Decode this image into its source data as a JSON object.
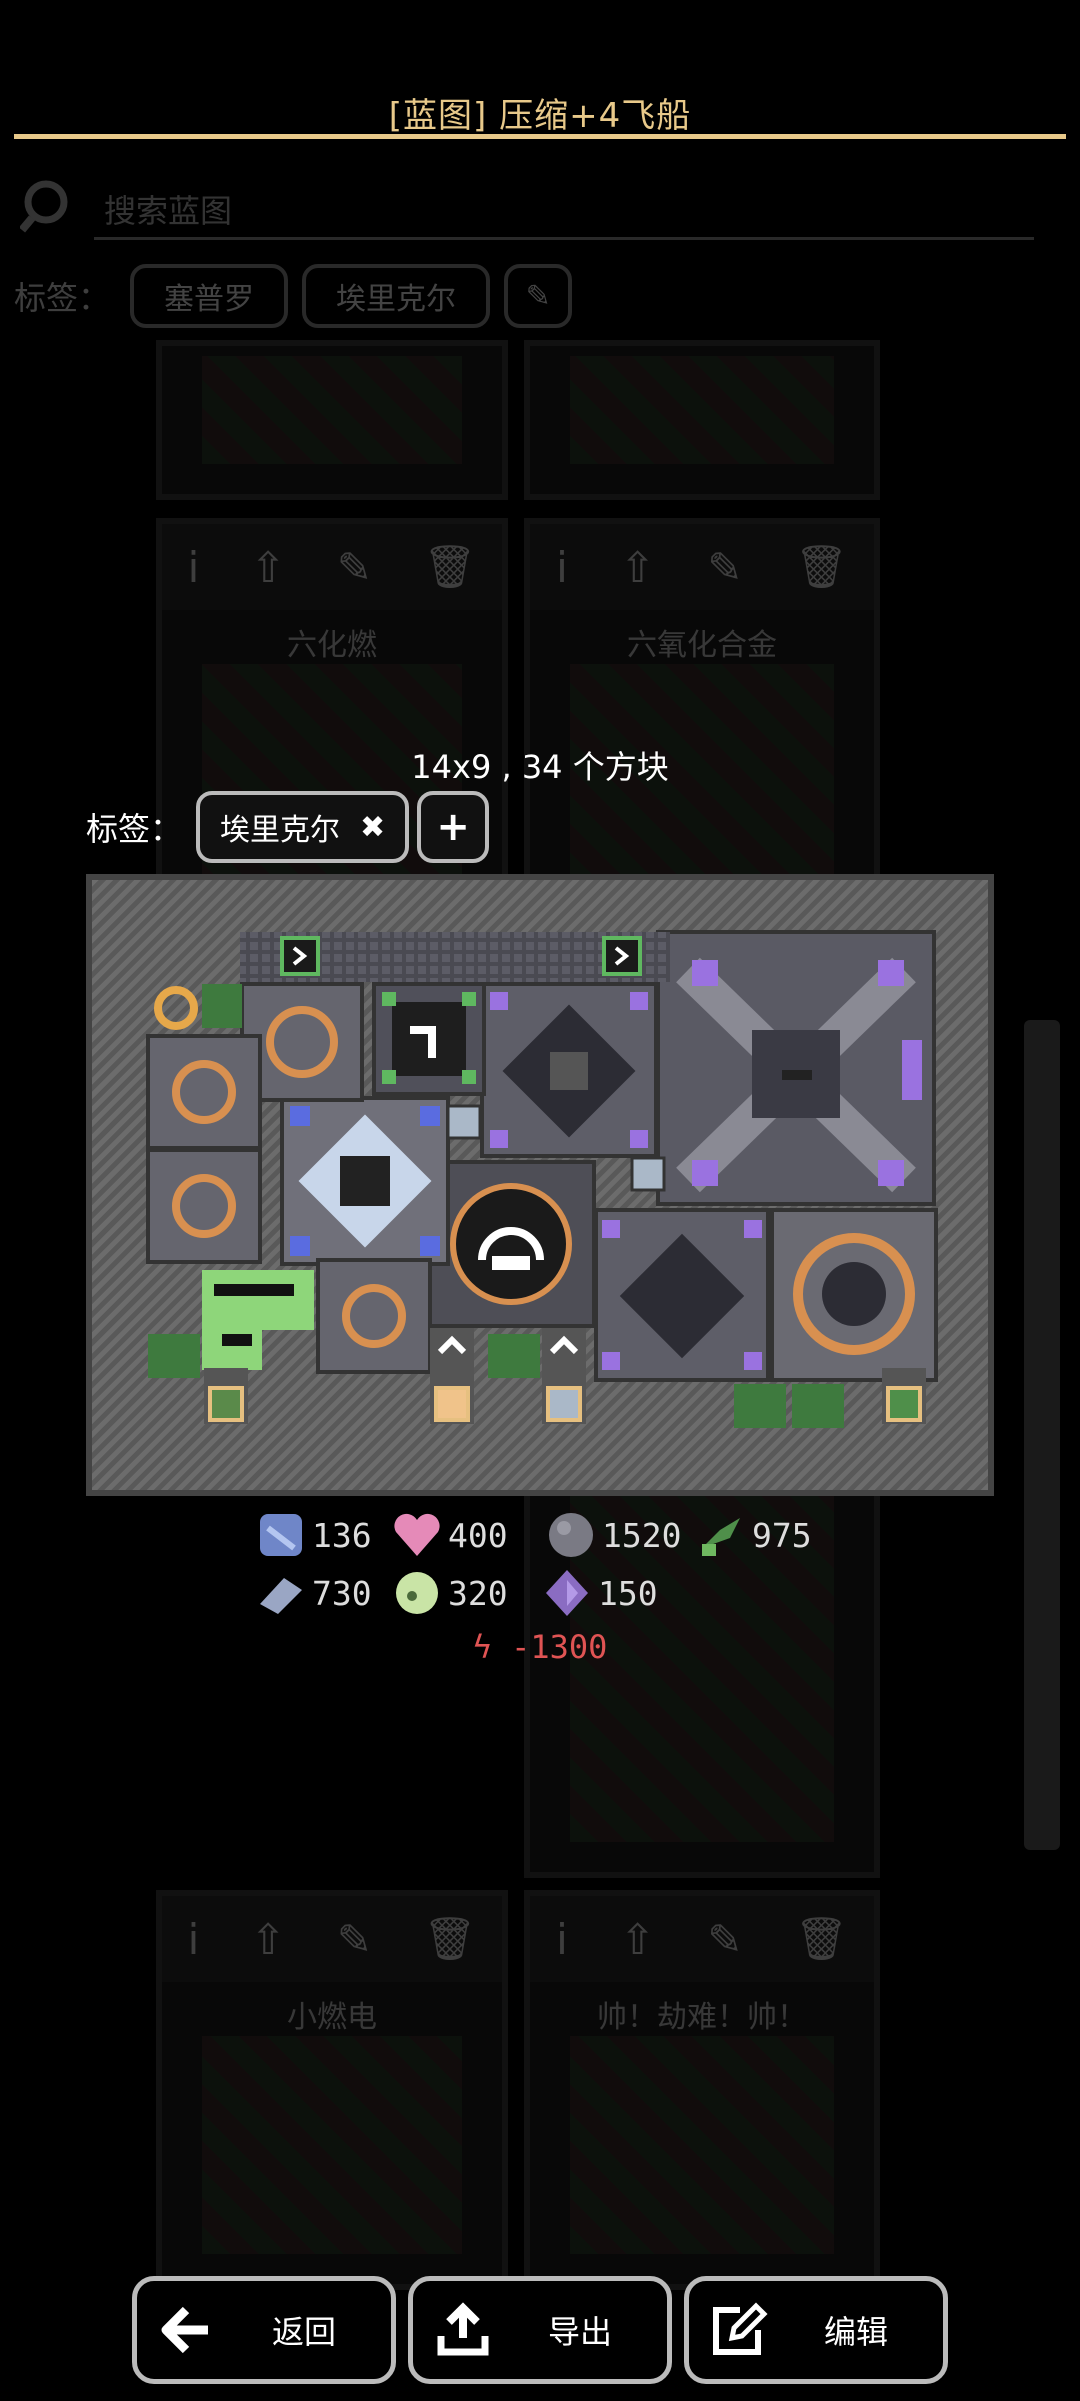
{
  "header": {
    "title": "[蓝图] 压缩+4飞船"
  },
  "background": {
    "search_placeholder": "搜索蓝图",
    "tags_label": "标签：",
    "tag_chips": [
      "塞普罗",
      "埃里克尔"
    ],
    "cards": [
      {
        "title": "六化燃"
      },
      {
        "title": "六氧化合金"
      },
      {
        "title": "小燃电"
      },
      {
        "title": "帅！劫难！帅！"
      }
    ]
  },
  "modal": {
    "dims": "14x9 , 34 个方块",
    "tags_label": "标签：",
    "tag": {
      "name": "埃里克尔",
      "remove": "✖"
    },
    "add_tag": "+",
    "resources_row1": [
      {
        "icon": "blue-crystal-icon",
        "amount": "136",
        "color": "#6f86c8"
      },
      {
        "icon": "pink-heart-icon",
        "amount": "400",
        "color": "#e58ab8"
      },
      {
        "icon": "gray-stone-icon",
        "amount": "1520",
        "color": "#7a7a84"
      },
      {
        "icon": "green-vine-icon",
        "amount": "975",
        "color": "#4f8f4a"
      }
    ],
    "resources_row2": [
      {
        "icon": "steel-bar-icon",
        "amount": "730",
        "color": "#9aa6c4"
      },
      {
        "icon": "lime-ore-icon",
        "amount": "320",
        "color": "#c9e4a6"
      },
      {
        "icon": "purple-crystal-icon",
        "amount": "150",
        "color": "#8a6cc2"
      }
    ],
    "power": "-1300"
  },
  "buttons": {
    "back": "返回",
    "export": "导出",
    "edit": "编辑"
  },
  "colors": {
    "accent": "#e8c98a",
    "power": "#e05454"
  }
}
